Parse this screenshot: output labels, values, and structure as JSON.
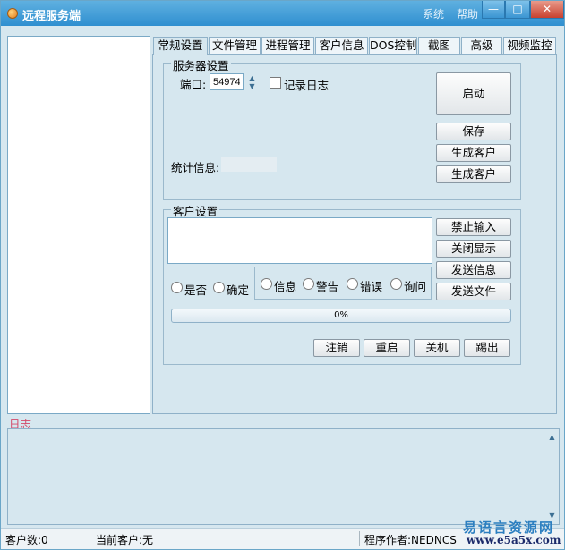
{
  "window": {
    "title": "远程服务端",
    "menu_system": "系统",
    "menu_help": "帮助",
    "minimize_glyph": "—",
    "maximize_glyph": "□",
    "close_glyph": "✕"
  },
  "tabs": [
    {
      "label": "常规设置",
      "active": true
    },
    {
      "label": "文件管理"
    },
    {
      "label": "进程管理"
    },
    {
      "label": "客户信息"
    },
    {
      "label": "DOS控制"
    },
    {
      "label": "截图"
    },
    {
      "label": "高级"
    },
    {
      "label": "视频监控"
    }
  ],
  "server_group": {
    "legend": "服务器设置",
    "port_label": "端口:",
    "port_value": "54974",
    "log_checkbox_label": "记录日志",
    "log_checked": false,
    "start_button": "启动",
    "save_button": "保存",
    "generate_client_button_1": "生成客户",
    "generate_client_button_2": "生成客户",
    "stats_label": "统计信息:"
  },
  "client_group": {
    "legend": "客户设置",
    "disable_input_button": "禁止输入",
    "close_display_button": "关闭显示",
    "send_info_button": "发送信息",
    "send_file_button": "发送文件",
    "radio_yes_no": "是否",
    "radio_confirm": "确定",
    "radio_info": "信息",
    "radio_warning": "警告",
    "radio_error": "错误",
    "radio_question": "询问",
    "progress_text": "0%",
    "progress": 0,
    "logout_button": "注销",
    "restart_button": "重启",
    "shutdown_button": "关机",
    "kick_button": "踢出"
  },
  "log": {
    "label": "日志"
  },
  "status": {
    "client_count": "客户数:0",
    "current_client": "当前客户:无",
    "author": "程序作者:NEDNCS"
  },
  "watermark": {
    "text": "易语言资源网",
    "url": "www.e5a5x.com"
  },
  "colors": {
    "title_bar": "#3a9ad8",
    "panel_bg": "#d6e7ef",
    "log_label": "#d44a6a"
  }
}
